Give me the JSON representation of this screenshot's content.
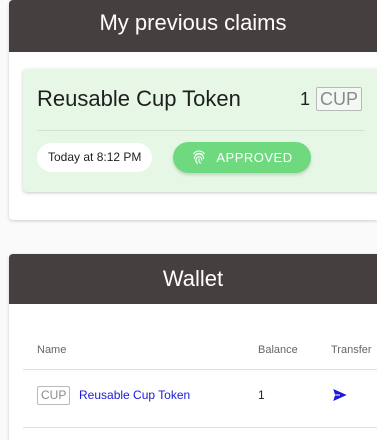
{
  "claims": {
    "header": "My previous claims",
    "item": {
      "title": "Reusable Cup Token",
      "amount": "1",
      "token": "CUP",
      "time": "Today at 8:12 PM",
      "status": "APPROVED",
      "status_icon": "fingerprint-icon",
      "status_color": "#6fd97f"
    }
  },
  "wallet": {
    "header": "Wallet",
    "columns": [
      "Name",
      "Balance",
      "Transfer"
    ],
    "rows": [
      {
        "token": "CUP",
        "name": "Reusable Cup Token",
        "balance": "1",
        "transfer_icon": "send-icon"
      }
    ]
  },
  "colors": {
    "header_bg": "#453f3f",
    "claim_bg": "#e6f7e6",
    "link": "#1b1bd6"
  }
}
